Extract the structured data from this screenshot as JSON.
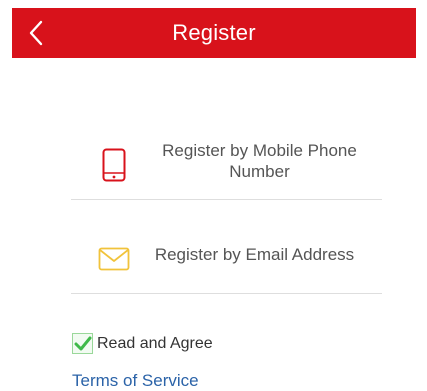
{
  "header": {
    "title": "Register",
    "back_icon": "chevron-left-icon",
    "background_color": "#d8121b"
  },
  "options": [
    {
      "label": "Register by Mobile Phone Number",
      "icon": "mobile-phone-icon",
      "icon_color": "#d8121b"
    },
    {
      "label": "Register by Email Address",
      "icon": "envelope-icon",
      "icon_color": "#f1c33b"
    }
  ],
  "agreement": {
    "checked": true,
    "label": "Read and Agree",
    "terms_link": "Terms of Service",
    "check_color": "#3fb94a"
  }
}
